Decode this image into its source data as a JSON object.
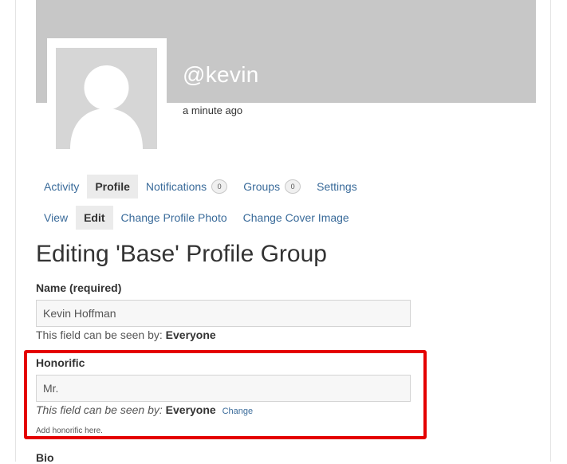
{
  "profile": {
    "username": "@kevin",
    "last_active": "a minute ago"
  },
  "nav": {
    "primary": [
      {
        "label": "Activity",
        "count": null,
        "active": false
      },
      {
        "label": "Profile",
        "count": null,
        "active": true
      },
      {
        "label": "Notifications",
        "count": "0",
        "active": false
      },
      {
        "label": "Groups",
        "count": "0",
        "active": false
      },
      {
        "label": "Settings",
        "count": null,
        "active": false
      }
    ],
    "secondary": [
      {
        "label": "View",
        "active": false
      },
      {
        "label": "Edit",
        "active": true
      },
      {
        "label": "Change Profile Photo",
        "active": false
      },
      {
        "label": "Change Cover Image",
        "active": false
      }
    ]
  },
  "page_title": "Editing 'Base' Profile Group",
  "fields": {
    "name": {
      "label": "Name (required)",
      "value": "Kevin Hoffman",
      "visibility_prefix": "This field can be seen by:",
      "visibility_value": "Everyone"
    },
    "honorific": {
      "label": "Honorific",
      "value": "Mr.",
      "visibility_prefix": "This field can be seen by:",
      "visibility_value": "Everyone",
      "change_label": "Change",
      "description": "Add honorific here."
    },
    "bio": {
      "label": "Bio"
    }
  },
  "colors": {
    "link": "#3a6b9a",
    "cover": "#c7c7c7",
    "highlight": "#e40000"
  }
}
